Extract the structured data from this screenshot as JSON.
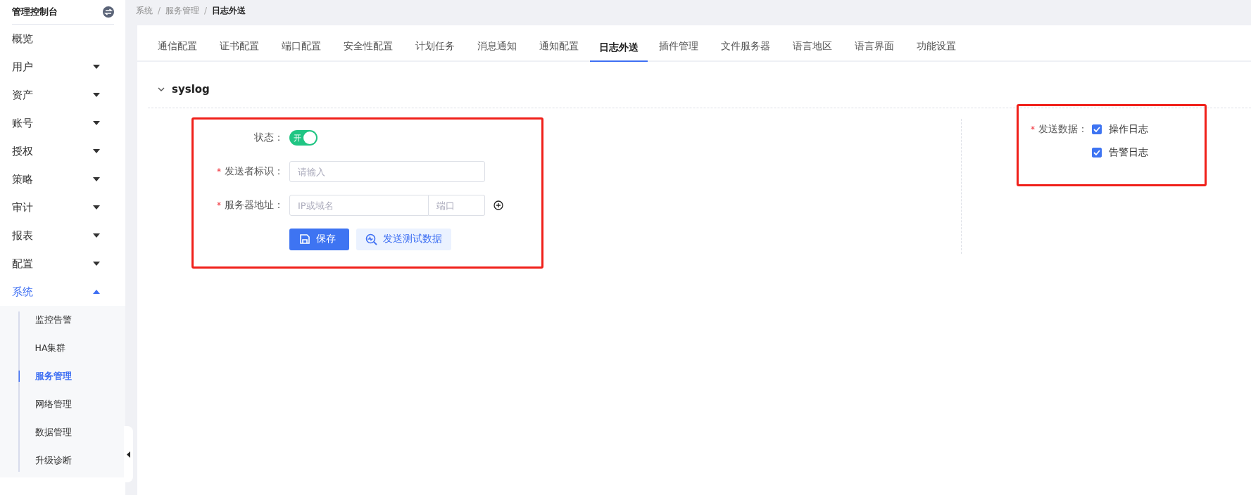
{
  "sidebar": {
    "title": "管理控制台",
    "items": [
      {
        "kind": "link",
        "label": "概览"
      },
      {
        "kind": "group",
        "label": "用户",
        "expanded": false
      },
      {
        "kind": "group",
        "label": "资产",
        "expanded": false
      },
      {
        "kind": "group",
        "label": "账号",
        "expanded": false
      },
      {
        "kind": "group",
        "label": "授权",
        "expanded": false
      },
      {
        "kind": "group",
        "label": "策略",
        "expanded": false
      },
      {
        "kind": "group",
        "label": "审计",
        "expanded": false
      },
      {
        "kind": "group",
        "label": "报表",
        "expanded": false
      },
      {
        "kind": "group",
        "label": "配置",
        "expanded": false
      },
      {
        "kind": "group",
        "label": "系统",
        "expanded": true,
        "children": [
          {
            "label": "监控告警",
            "selected": false
          },
          {
            "label": "HA集群",
            "selected": false
          },
          {
            "label": "服务管理",
            "selected": true
          },
          {
            "label": "网络管理",
            "selected": false
          },
          {
            "label": "数据管理",
            "selected": false
          },
          {
            "label": "升级诊断",
            "selected": false
          }
        ]
      }
    ]
  },
  "breadcrumb": {
    "items": [
      "系统",
      "服务管理",
      "日志外送"
    ],
    "separators": [
      "/",
      "/"
    ]
  },
  "tabs": [
    {
      "label": "通信配置",
      "selected": false
    },
    {
      "label": "证书配置",
      "selected": false
    },
    {
      "label": "端口配置",
      "selected": false
    },
    {
      "label": "安全性配置",
      "selected": false
    },
    {
      "label": "计划任务",
      "selected": false
    },
    {
      "label": "消息通知",
      "selected": false
    },
    {
      "label": "通知配置",
      "selected": false
    },
    {
      "label": "日志外送",
      "selected": true
    },
    {
      "label": "插件管理",
      "selected": false
    },
    {
      "label": "文件服务器",
      "selected": false
    },
    {
      "label": "语言地区",
      "selected": false
    },
    {
      "label": "语言界面",
      "selected": false
    },
    {
      "label": "功能设置",
      "selected": false
    }
  ],
  "section": {
    "title": "syslog",
    "expanded": true
  },
  "form": {
    "highlighted": true,
    "fields": [
      {
        "kind": "switch",
        "label": "状态：",
        "on": true,
        "switch_text": "开"
      },
      {
        "kind": "text",
        "required_mark": "*",
        "label": "发送者标识：",
        "placeholder": "请输入"
      },
      {
        "kind": "address",
        "required_mark": "*",
        "label": "服务器地址：",
        "host_placeholder": "IP或域名",
        "port_placeholder": "端口"
      }
    ],
    "buttons": [
      {
        "kind": "primary",
        "label": "保存"
      },
      {
        "kind": "secondary",
        "label": "发送测试数据"
      }
    ]
  },
  "send_data": {
    "highlighted": true,
    "required_mark": "*",
    "label": "发送数据：",
    "options": [
      {
        "label": "操作日志",
        "checked": true
      },
      {
        "label": "告警日志",
        "checked": true
      }
    ]
  }
}
